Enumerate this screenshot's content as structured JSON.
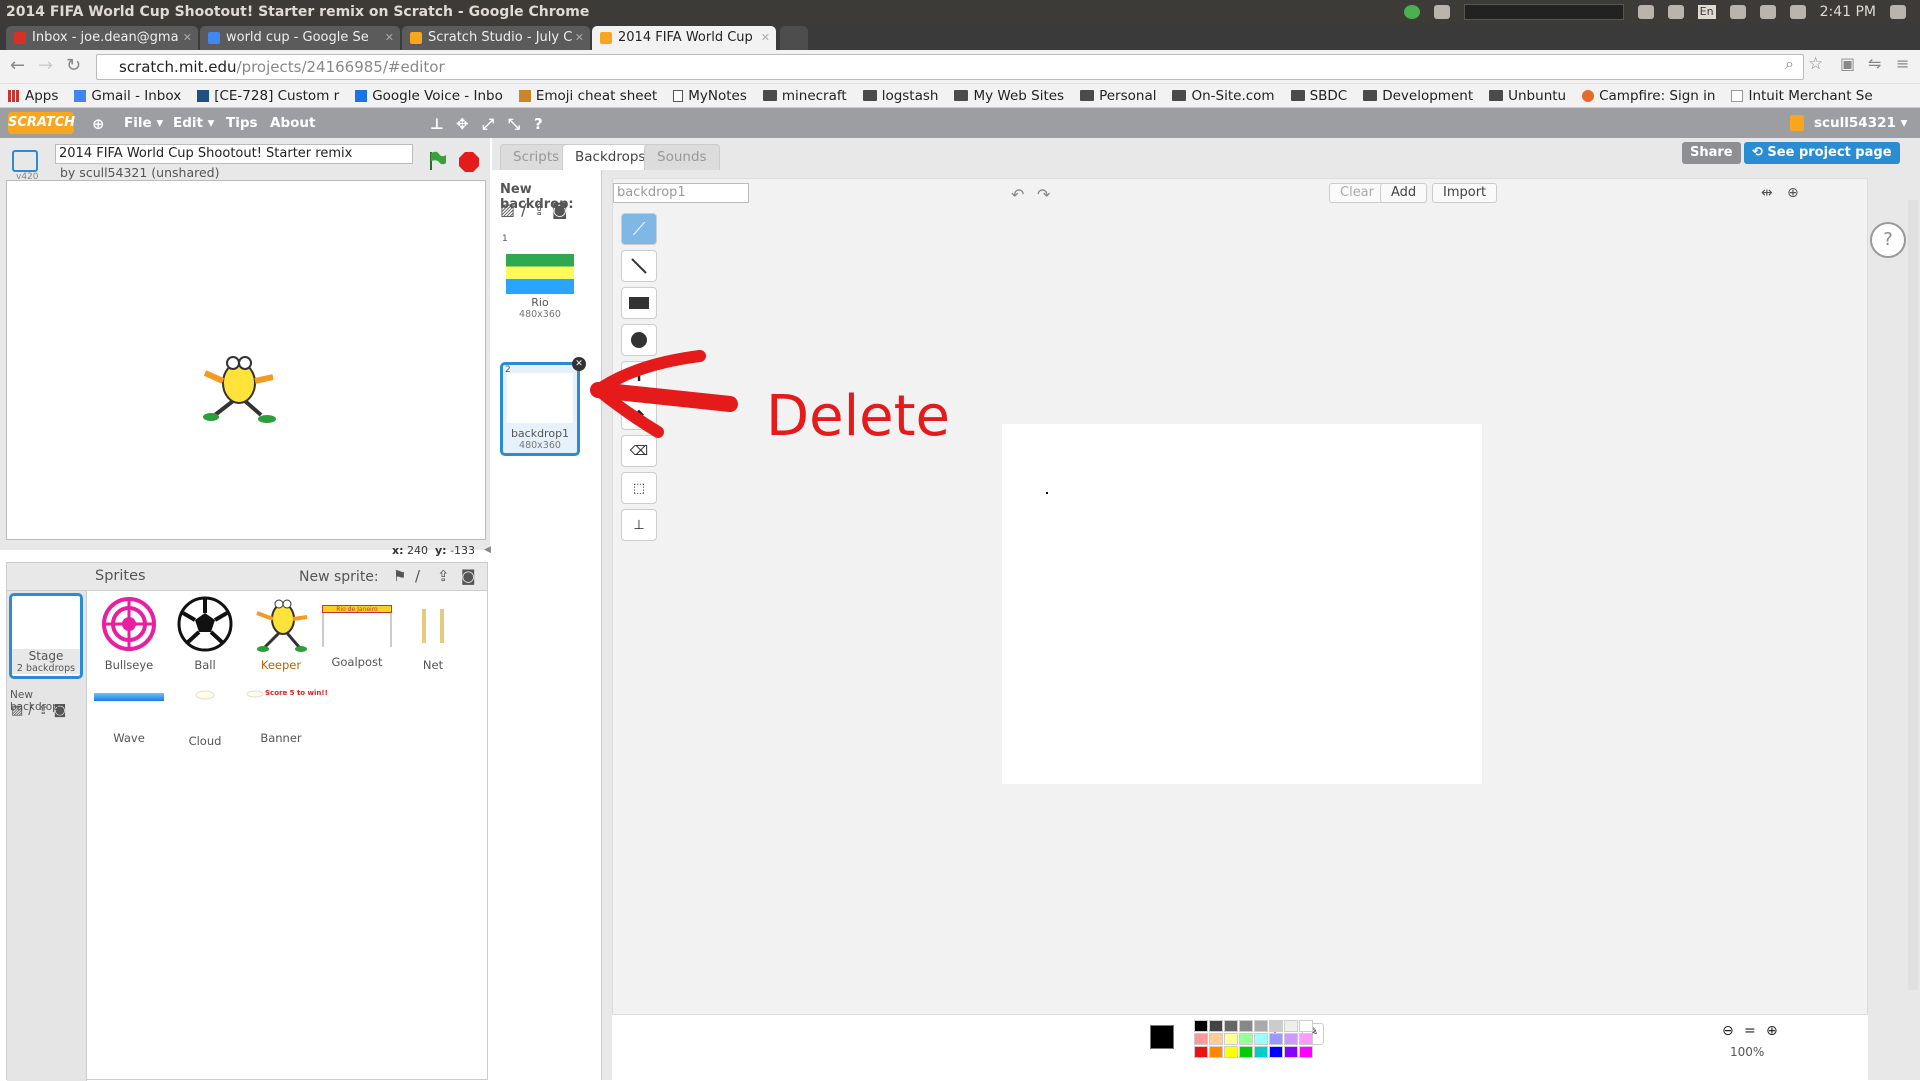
{
  "os": {
    "window_title": "2014 FIFA World Cup Shootout! Starter remix on Scratch - Google Chrome",
    "clock": "2:41 PM",
    "keyboard": "En"
  },
  "tabs": [
    {
      "label": "Inbox - joe.dean@gma",
      "icon": "gmail-icon",
      "color": "#d93025"
    },
    {
      "label": "world cup - Google Se",
      "icon": "google-icon",
      "color": "#4285f4"
    },
    {
      "label": "Scratch Studio - July C",
      "icon": "scratch-icon",
      "color": "#f7a61d"
    },
    {
      "label": "2014 FIFA World Cup",
      "icon": "scratch-icon",
      "color": "#f7a61d"
    }
  ],
  "address": {
    "url_host": "scratch.mit.edu",
    "url_path": "/projects/24166985/#editor"
  },
  "bookmarks": [
    {
      "label": "Apps",
      "icon": "apps-icon"
    },
    {
      "label": "Gmail - Inbox",
      "icon": "google-icon"
    },
    {
      "label": "[CE-728] Custom r",
      "icon": "jira-icon"
    },
    {
      "label": "Google Voice - Inbo",
      "icon": "voice-icon"
    },
    {
      "label": "Emoji cheat sheet",
      "icon": "emoji-icon"
    },
    {
      "label": "MyNotes",
      "icon": "page-icon"
    },
    {
      "label": "minecraft",
      "icon": "folder-icon"
    },
    {
      "label": "logstash",
      "icon": "folder-icon"
    },
    {
      "label": "My Web Sites",
      "icon": "folder-icon"
    },
    {
      "label": "Personal",
      "icon": "folder-icon"
    },
    {
      "label": "On-Site.com",
      "icon": "folder-icon"
    },
    {
      "label": "SBDC",
      "icon": "folder-icon"
    },
    {
      "label": "Development",
      "icon": "folder-icon"
    },
    {
      "label": "Unbuntu",
      "icon": "folder-icon"
    },
    {
      "label": "Campfire: Sign in",
      "icon": "campfire-icon"
    },
    {
      "label": "Intuit Merchant Se",
      "icon": "intuit-icon"
    }
  ],
  "scratch_menu": {
    "logo": "SCRATCH",
    "items": [
      "File ▾",
      "Edit ▾",
      "Tips",
      "About"
    ],
    "user": "scull54321 ▾"
  },
  "project": {
    "title": "2014 FIFA World Cup Shootout! Starter remix",
    "byline": "by scull54321 (unshared)",
    "version": "v420",
    "share": "Share",
    "see_page": "See project page"
  },
  "coords": {
    "x_label": "x:",
    "x": "240",
    "y_label": "y:",
    "y": "-133"
  },
  "sprites_panel": {
    "title": "Sprites",
    "new_sprite": "New sprite:",
    "stage_label": "Stage",
    "stage_sub": "2 backdrops",
    "new_backdrop": "New backdrop:",
    "sprites": [
      "Bullseye",
      "Ball",
      "Keeper",
      "Goalpost",
      "Net",
      "Wave",
      "Cloud",
      "Banner"
    ],
    "banner_text": "Score 5 to win!!",
    "goalpost_text": "Rio de Janeiro"
  },
  "editor": {
    "tabs": [
      "Scripts",
      "Backdrops",
      "Sounds"
    ],
    "active_tab": "Backdrops",
    "new_backdrop": "New backdrop:",
    "backdrops": [
      {
        "num": "1",
        "name": "Rio",
        "size": "480x360"
      },
      {
        "num": "2",
        "name": "backdrop1",
        "size": "480x360"
      }
    ],
    "name_field": "backdrop1",
    "clear": "Clear",
    "add": "Add",
    "import": "Import",
    "zoom": "100%"
  },
  "annotation": {
    "text": "Delete",
    "color": "#e51a1a"
  }
}
